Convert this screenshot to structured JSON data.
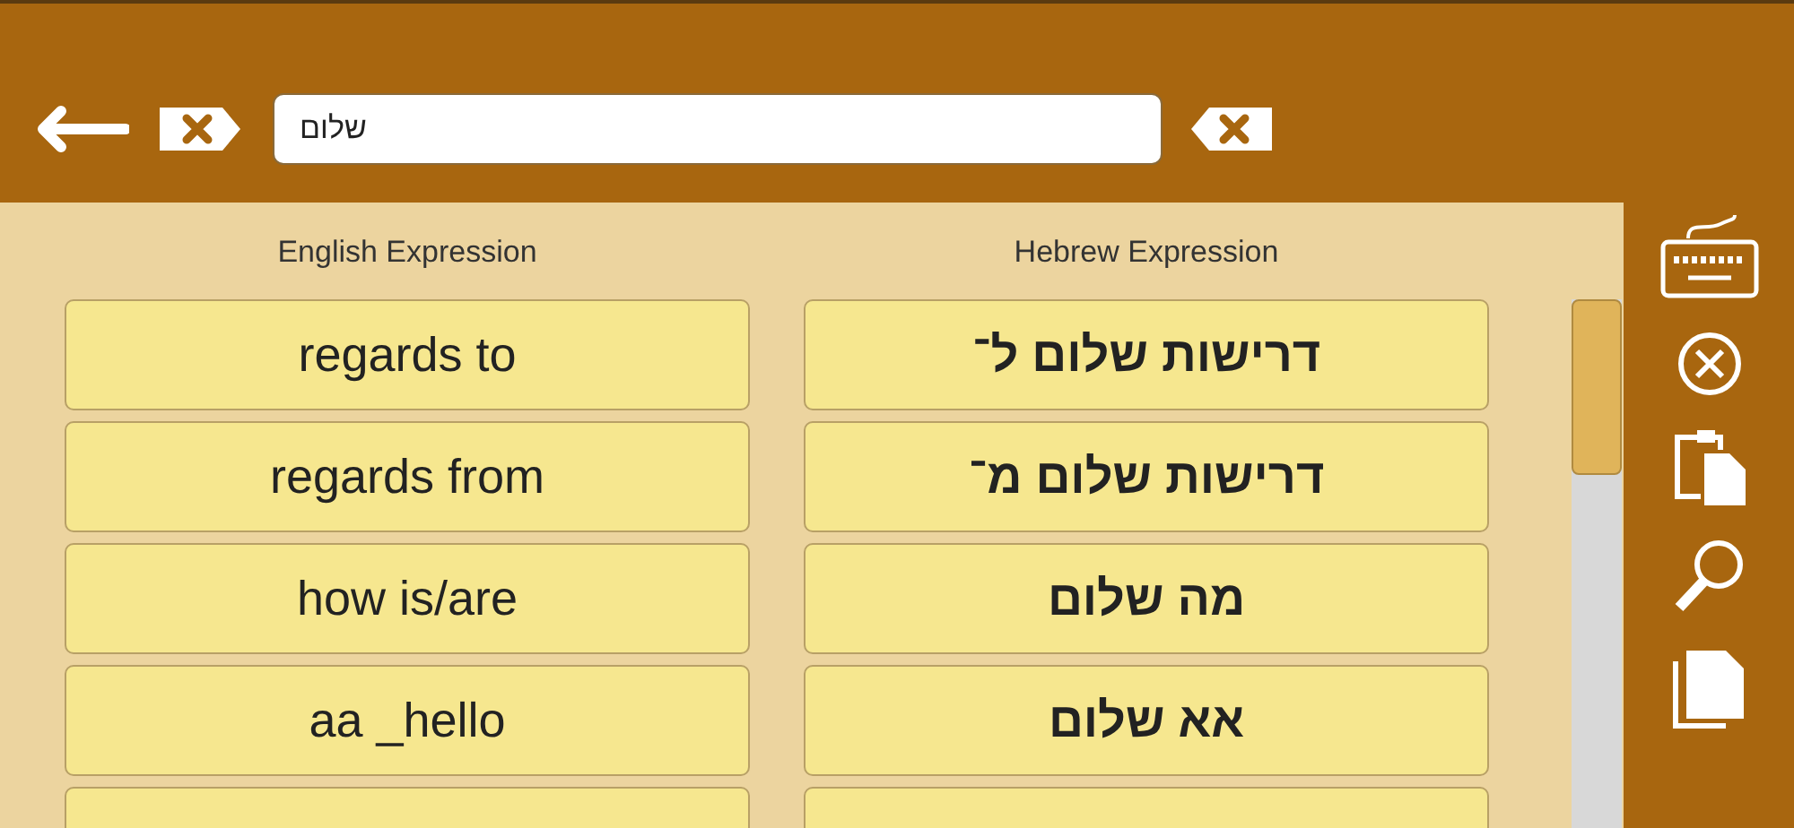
{
  "search": {
    "value": "שלום"
  },
  "english_header": "English Expression",
  "hebrew_header": "Hebrew Expression",
  "rows": [
    {
      "english": "regards to",
      "hebrew": "דרישות שלום ל־"
    },
    {
      "english": "regards from",
      "hebrew": "דרישות שלום מ־"
    },
    {
      "english": "how is/are",
      "hebrew": "מה שלום"
    },
    {
      "english": "aa _hello",
      "hebrew": "אא שלום"
    }
  ]
}
